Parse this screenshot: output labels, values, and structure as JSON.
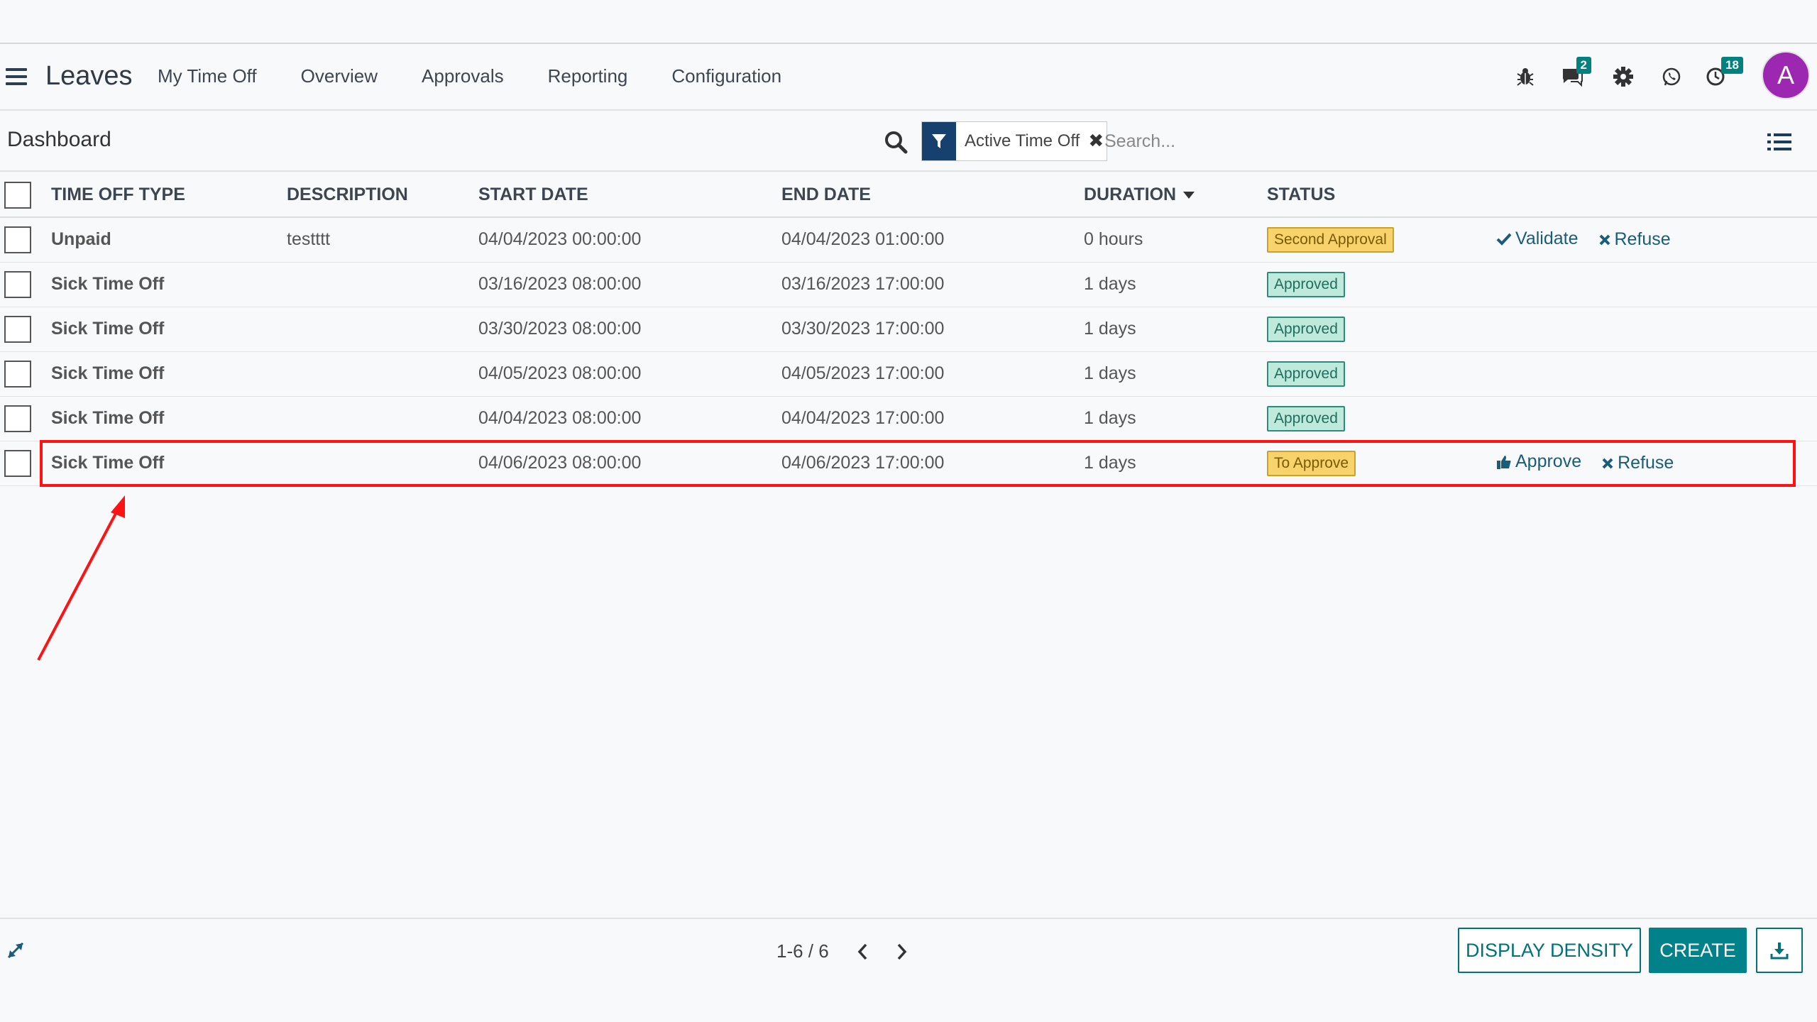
{
  "app": {
    "title": "Leaves",
    "menu": [
      "My Time Off",
      "Overview",
      "Approvals",
      "Reporting",
      "Configuration"
    ],
    "messages_badge": "2",
    "activities_badge": "18",
    "avatar_initial": "A",
    "avatar_color": "#9c27b0"
  },
  "control": {
    "breadcrumb": "Dashboard",
    "filter_facet": "Active Time Off",
    "search_placeholder": "Search..."
  },
  "table": {
    "columns": [
      "TIME OFF TYPE",
      "DESCRIPTION",
      "START DATE",
      "END DATE",
      "DURATION",
      "STATUS"
    ],
    "sorted_column": "DURATION",
    "rows": [
      {
        "type": "Unpaid",
        "description": "testttt",
        "start": "04/04/2023 00:00:00",
        "end": "04/04/2023 01:00:00",
        "duration": "0 hours",
        "status": "Second Approval",
        "status_kind": "warning",
        "actions": [
          "Validate",
          "Refuse"
        ]
      },
      {
        "type": "Sick Time Off",
        "description": "",
        "start": "03/16/2023 08:00:00",
        "end": "03/16/2023 17:00:00",
        "duration": "1 days",
        "status": "Approved",
        "status_kind": "success",
        "actions": []
      },
      {
        "type": "Sick Time Off",
        "description": "",
        "start": "03/30/2023 08:00:00",
        "end": "03/30/2023 17:00:00",
        "duration": "1 days",
        "status": "Approved",
        "status_kind": "success",
        "actions": []
      },
      {
        "type": "Sick Time Off",
        "description": "",
        "start": "04/05/2023 08:00:00",
        "end": "04/05/2023 17:00:00",
        "duration": "1 days",
        "status": "Approved",
        "status_kind": "success",
        "actions": []
      },
      {
        "type": "Sick Time Off",
        "description": "",
        "start": "04/04/2023 08:00:00",
        "end": "04/04/2023 17:00:00",
        "duration": "1 days",
        "status": "Approved",
        "status_kind": "success",
        "actions": []
      },
      {
        "type": "Sick Time Off",
        "description": "",
        "start": "04/06/2023 08:00:00",
        "end": "04/06/2023 17:00:00",
        "duration": "1 days",
        "status": "To Approve",
        "status_kind": "warning",
        "actions": [
          "Approve",
          "Refuse"
        ]
      }
    ]
  },
  "footer": {
    "pager": "1-6 / 6",
    "display_density_label": "DISPLAY DENSITY",
    "create_label": "CREATE"
  },
  "colors": {
    "primary": "#01828a",
    "facet": "#16416e",
    "annotation": "#ff1212",
    "approved": "#bfe9da",
    "warning": "#f8d26b"
  }
}
